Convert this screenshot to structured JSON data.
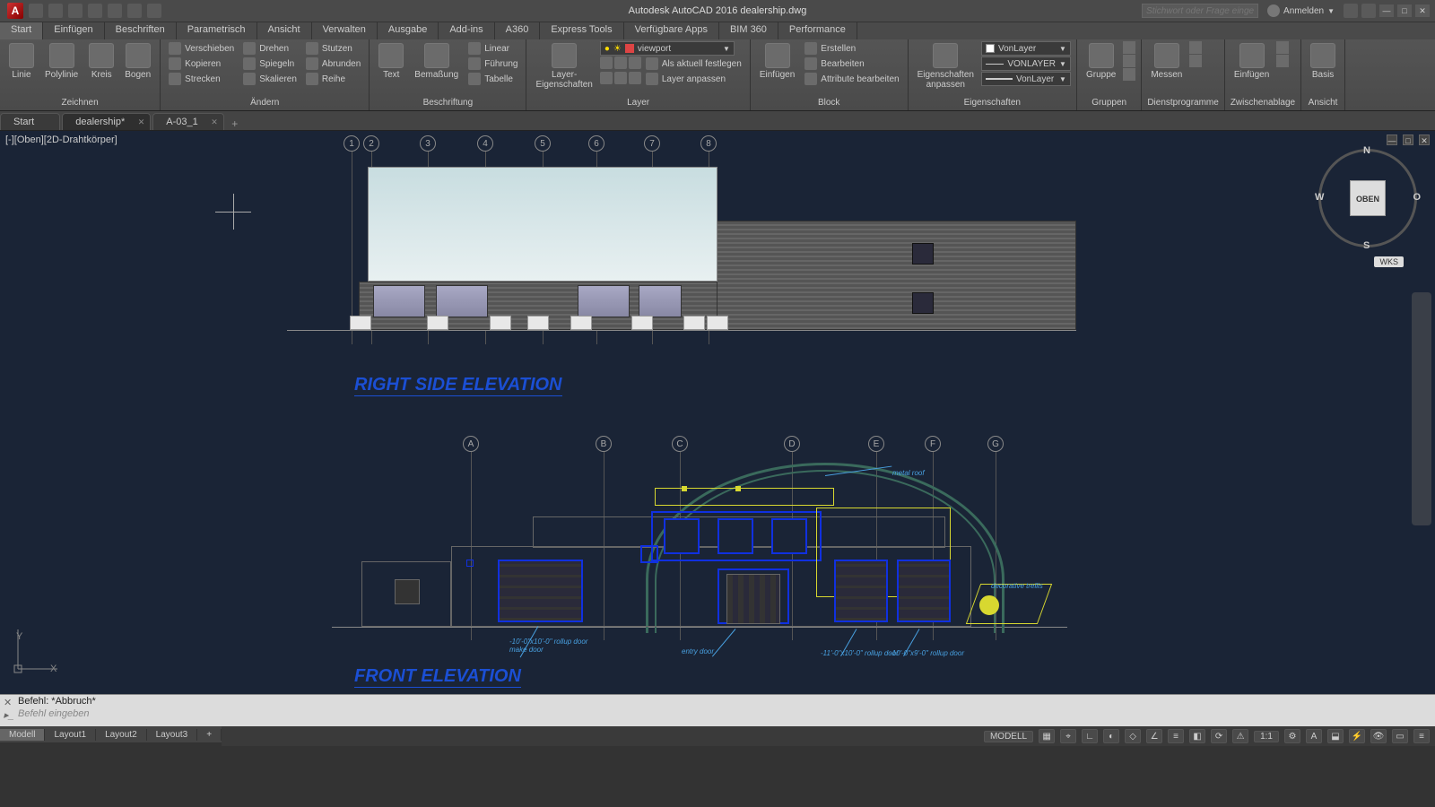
{
  "title": "Autodesk AutoCAD 2016   dealership.dwg",
  "search_placeholder": "Stichwort oder Frage eingeben",
  "user": "Anmelden",
  "menu": [
    "Start",
    "Einfügen",
    "Beschriften",
    "Parametrisch",
    "Ansicht",
    "Verwalten",
    "Ausgabe",
    "Add-ins",
    "A360",
    "Express Tools",
    "Verfügbare Apps",
    "BIM 360",
    "Performance"
  ],
  "menu_active": 0,
  "ribbon": {
    "draw": {
      "title": "Zeichnen",
      "buttons": [
        "Linie",
        "Polylinie",
        "Kreis",
        "Bogen"
      ]
    },
    "modify": {
      "title": "Ändern",
      "rows": [
        [
          "Verschieben",
          "Drehen",
          "Stutzen"
        ],
        [
          "Kopieren",
          "Spiegeln",
          "Abrunden"
        ],
        [
          "Strecken",
          "Skalieren",
          "Reihe"
        ]
      ]
    },
    "annotate": {
      "title": "Beschriftung",
      "big": [
        "Text",
        "Bemaßung"
      ],
      "rows": [
        [
          "Linear"
        ],
        [
          "Führung"
        ],
        [
          "Tabelle"
        ]
      ]
    },
    "layers": {
      "title": "Layer",
      "big": "Layer-\nEigenschaften",
      "current": "viewport",
      "rows": [
        [
          "",
          "",
          ""
        ],
        [
          "Als aktuell festlegen"
        ],
        [
          "Layer anpassen"
        ]
      ]
    },
    "block": {
      "title": "Block",
      "big": "Einfügen",
      "rows": [
        [
          "Erstellen"
        ],
        [
          "Bearbeiten"
        ],
        [
          "Attribute bearbeiten"
        ]
      ]
    },
    "props": {
      "title": "Eigenschaften",
      "big": "Eigenschaften\nanpassen",
      "color": "VonLayer",
      "ltype": "VONLAYER",
      "lweight": "VonLayer"
    },
    "groups": {
      "title": "Gruppen",
      "big": "Gruppe"
    },
    "utils": {
      "title": "Dienstprogramme",
      "big": "Messen"
    },
    "clip": {
      "title": "Zwischenablage",
      "big": "Einfügen"
    },
    "view": {
      "title": "Ansicht",
      "big": "Basis"
    }
  },
  "file_tabs": [
    "Start",
    "dealership*",
    "A-03_1"
  ],
  "file_tab_active": 1,
  "viewport_label": "[-][Oben][2D-Drahtkörper]",
  "navcube": {
    "face": "OBEN",
    "n": "N",
    "s": "S",
    "e": "O",
    "w": "W",
    "wks": "WKS"
  },
  "drawing": {
    "rse_title": "RIGHT SIDE ELEVATION",
    "fe_title": "FRONT ELEVATION",
    "rse_grids": [
      "1",
      "2",
      "3",
      "4",
      "5",
      "6",
      "7",
      "8"
    ],
    "fe_grids": [
      "A",
      "B",
      "C",
      "D",
      "E",
      "F",
      "G"
    ],
    "fe_labels": {
      "metal_roof": "metal roof",
      "entry_door": "entry door",
      "rollup1": "-10'-0\"x10'-0\" rollup door\nmake door",
      "rollup2": "-11'-0\"x10'-0\" rollup door",
      "rollup3": "-10'-0\"x9'-0\" rollup door",
      "decorative": "decorative trellis"
    }
  },
  "command": {
    "history": "Befehl: *Abbruch*",
    "prompt": "Befehl eingeben"
  },
  "layout_tabs": [
    "Modell",
    "Layout1",
    "Layout2",
    "Layout3"
  ],
  "layout_active": 0,
  "status": {
    "mode": "MODELL",
    "scale": "1:1"
  }
}
